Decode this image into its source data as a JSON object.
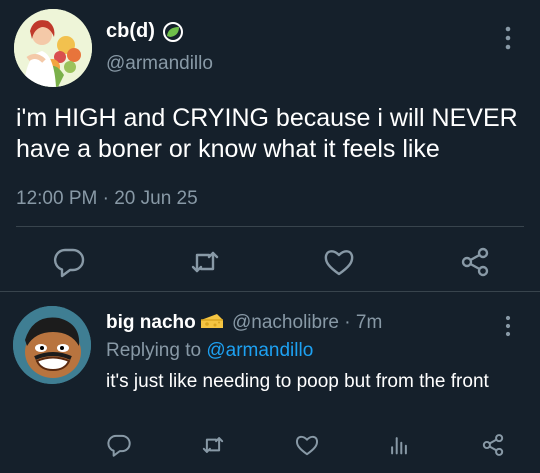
{
  "main_tweet": {
    "author_name": "cb(d)",
    "author_handle": "@armandillo",
    "text": "i'm HIGH and CRYING because i will NEVER have a boner or know what it feels like",
    "time": "12:00 PM",
    "separator": "·",
    "date": "20 Jun 25",
    "actions": [
      "reply-icon",
      "retweet-icon",
      "like-icon",
      "share-icon"
    ]
  },
  "reply_tweet": {
    "author_name": "big nacho",
    "author_handle": "@nacholibre",
    "separator": "·",
    "time_ago": "7m",
    "replying_label": "Replying to",
    "replying_to": "@armandillo",
    "text": "it's just like needing to poop but from the front",
    "actions": [
      "reply-icon",
      "retweet-icon",
      "like-icon",
      "analytics-icon",
      "share-icon"
    ]
  },
  "colors": {
    "background": "#15202b",
    "text": "#ffffff",
    "secondary_text": "#8899a6",
    "link": "#1da1f2",
    "divider": "#38444d"
  }
}
